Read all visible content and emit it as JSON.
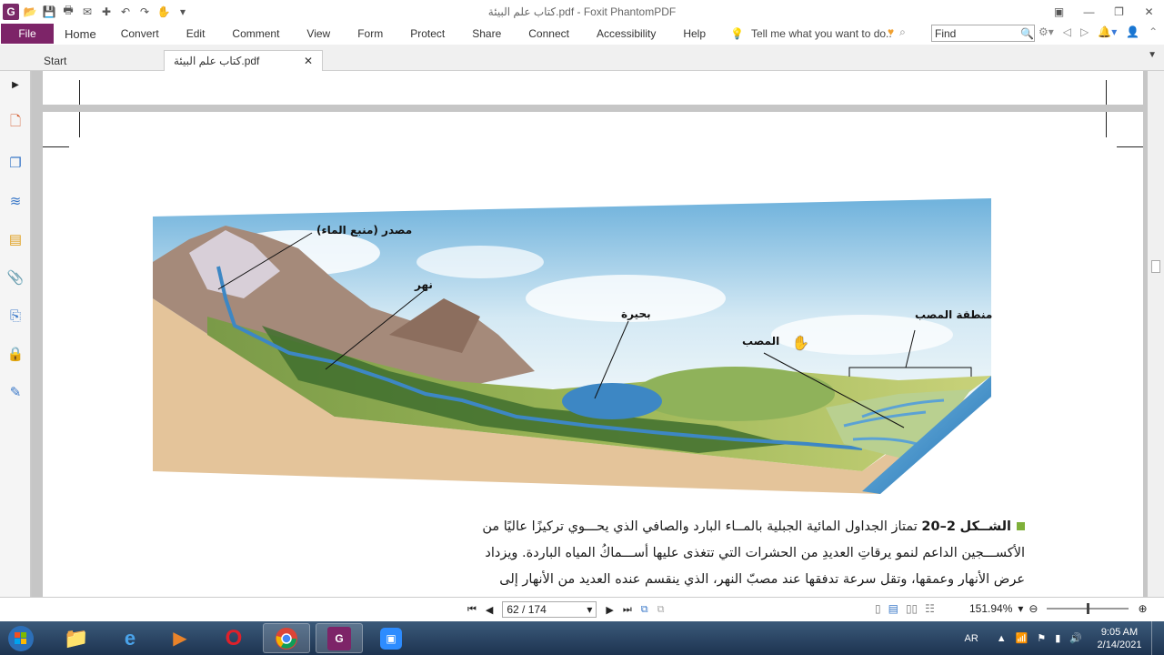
{
  "window": {
    "title": "كتاب علم البيئة.pdf - Foxit PhantomPDF"
  },
  "menu": {
    "file": "File",
    "items": [
      "Home",
      "Convert",
      "Edit",
      "Comment",
      "View",
      "Form",
      "Protect",
      "Share",
      "Connect",
      "Accessibility",
      "Help"
    ],
    "tell_me": "Tell me what you want to do..",
    "find_placeholder": "Find"
  },
  "tabs": {
    "start": "Start",
    "document": "كتاب علم البيئة.pdf"
  },
  "figure": {
    "labels": {
      "source": "مصدر (منبع الماء)",
      "river": "نهر",
      "lake": "بحيرة",
      "mouth": "المصب",
      "mouth_area": "منطقة المصب"
    }
  },
  "caption": {
    "figure_word": "الشــكل",
    "figure_number": "2–20",
    "line1": "تمتاز الجداول المائية الجبلية بالمــاء البارد والصافي الذي يحـــوي تركيزًا عاليًا من",
    "line2": "الأكســـجين الداعم لنمو يرقاتِ العديدِ من الحشرات التي تتغذى عليها أســـماكُ المياه الباردة. ويزداد",
    "line3": "عرض الأنهار وعمقها، وتقل سرعة تدفقها عند مصبّ النهر، الذي ينقسم عنده العديد من الأنهار إلى"
  },
  "status": {
    "page_field": "62 / 174",
    "zoom": "151.94%"
  },
  "tray": {
    "lang": "AR",
    "time": "9:05 AM",
    "date": "2/14/2021"
  },
  "colors": {
    "brand": "#7d2468",
    "bullet": "#7fb03a"
  }
}
